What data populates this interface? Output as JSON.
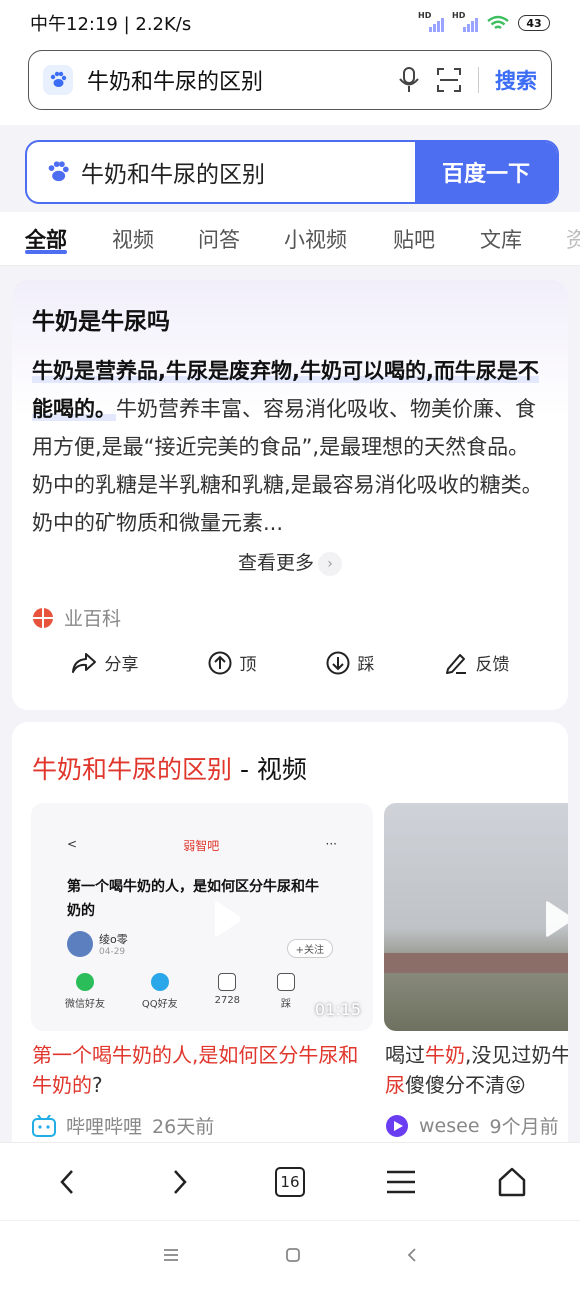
{
  "status_bar": {
    "time_speed": "中午12:19 | 2.2K/s",
    "net1": "HD",
    "net2": "HD",
    "battery": "43"
  },
  "address_bar": {
    "query": "牛奶和牛尿的区别",
    "search_label": "搜索"
  },
  "search_box": {
    "query": "牛奶和牛尿的区别",
    "button_label": "百度一下"
  },
  "tabs": [
    {
      "label": "全部",
      "active": true
    },
    {
      "label": "视频"
    },
    {
      "label": "问答"
    },
    {
      "label": "小视频"
    },
    {
      "label": "贴吧"
    },
    {
      "label": "文库"
    },
    {
      "label": "资"
    }
  ],
  "answer_card": {
    "title": "牛奶是牛尿吗",
    "highlight": "牛奶是营养品,牛尿是废弃物,牛奶可以喝的,而牛尿是不能喝的。",
    "body": "牛奶营养丰富、容易消化吸收、物美价廉、食用方便,是最“接近完美的食品”,是最理想的天然食品。奶中的乳糖是半乳糖和乳糖,是最容易消化吸收的糖类。奶中的矿物质和微量元素...",
    "more_label": "查看更多",
    "source": "业百科",
    "actions": {
      "share": "分享",
      "up": "顶",
      "down": "踩",
      "feedback": "反馈"
    }
  },
  "video_card": {
    "title_highlight": "牛奶和牛尿的区别",
    "title_suffix": " - 视频",
    "videos": [
      {
        "duration": "01:15",
        "thumb_forum": "弱智吧",
        "thumb_text": "第一个喝牛奶的人，是如何区分牛尿和牛奶的",
        "thumb_user": "绫o零",
        "thumb_date": "04-29",
        "thumb_follow": "+关注",
        "thumb_shares": [
          "微信好友",
          "QQ好友",
          "2728",
          "踩"
        ],
        "caption_red1": "第一个喝牛奶的人,是如何区分牛尿和牛奶的",
        "caption_tail": "?",
        "source": "哔哩哔哩",
        "time": "26天前"
      },
      {
        "caption_p1": "喝过",
        "caption_r1": "牛奶",
        "caption_p2": ",没见过奶牛",
        "caption_r2": "尿",
        "caption_p3": "傻傻分不清😝",
        "source": "wesee",
        "time": "9个月前"
      }
    ]
  },
  "bottom_nav": {
    "tab_count": "16"
  },
  "colors": {
    "accent": "#4e6ef2",
    "highlight_red": "#e0362c",
    "address_search": "#3b6cf6"
  }
}
